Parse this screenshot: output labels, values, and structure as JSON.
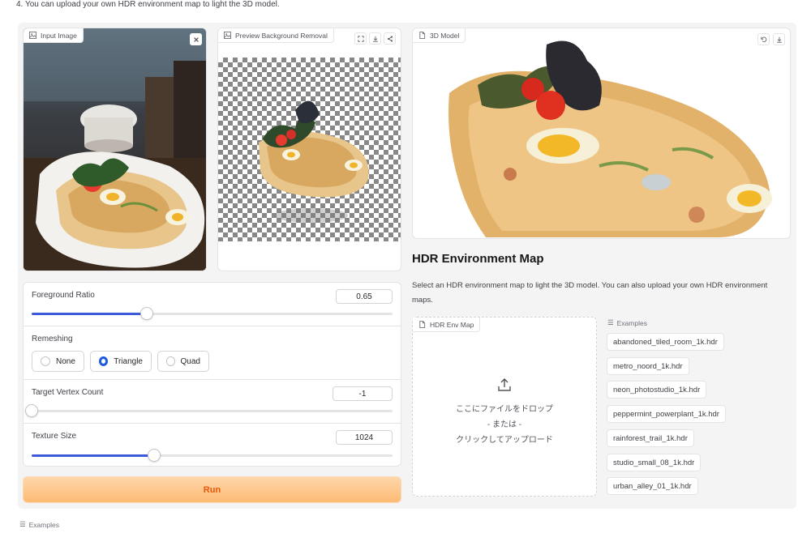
{
  "top_note": "4. You can upload your own HDR environment map to light the 3D model.",
  "input_image": {
    "label": "Input Image"
  },
  "preview": {
    "label": "Preview Background Removal"
  },
  "model3d": {
    "label": "3D Model"
  },
  "controls": {
    "foreground_ratio": {
      "label": "Foreground Ratio",
      "value": "0.65",
      "fraction": 0.32
    },
    "remeshing": {
      "label": "Remeshing",
      "options": [
        "None",
        "Triangle",
        "Quad"
      ],
      "selected": "Triangle"
    },
    "target_vertex_count": {
      "label": "Target Vertex Count",
      "value": "-1",
      "fraction": 0.0
    },
    "texture_size": {
      "label": "Texture Size",
      "value": "1024",
      "fraction": 0.34
    }
  },
  "run_button": "Run",
  "hdr": {
    "title": "HDR Environment Map",
    "description": "Select an HDR environment map to light the 3D model. You can also upload your own HDR environment maps.",
    "env_label": "HDR Env Map",
    "drop_line1": "ここにファイルをドロップ",
    "drop_line2": "- または -",
    "drop_line3": "クリックしてアップロード",
    "examples_label": "Examples",
    "examples": [
      "abandoned_tiled_room_1k.hdr",
      "metro_noord_1k.hdr",
      "neon_photostudio_1k.hdr",
      "peppermint_powerplant_1k.hdr",
      "rainforest_trail_1k.hdr",
      "studio_small_08_1k.hdr",
      "urban_alley_01_1k.hdr"
    ]
  },
  "bottom_examples_label": "Examples",
  "colors": {
    "accent": "#3b5bdb",
    "radio_selected": "#1d5be0",
    "run_text": "#ea580c",
    "run_bg": "#fdba74"
  },
  "icons": [
    "image-icon",
    "close-icon",
    "fullscreen-icon",
    "download-icon",
    "share-icon",
    "file-icon",
    "undo-icon",
    "upload-icon",
    "list-icon"
  ]
}
